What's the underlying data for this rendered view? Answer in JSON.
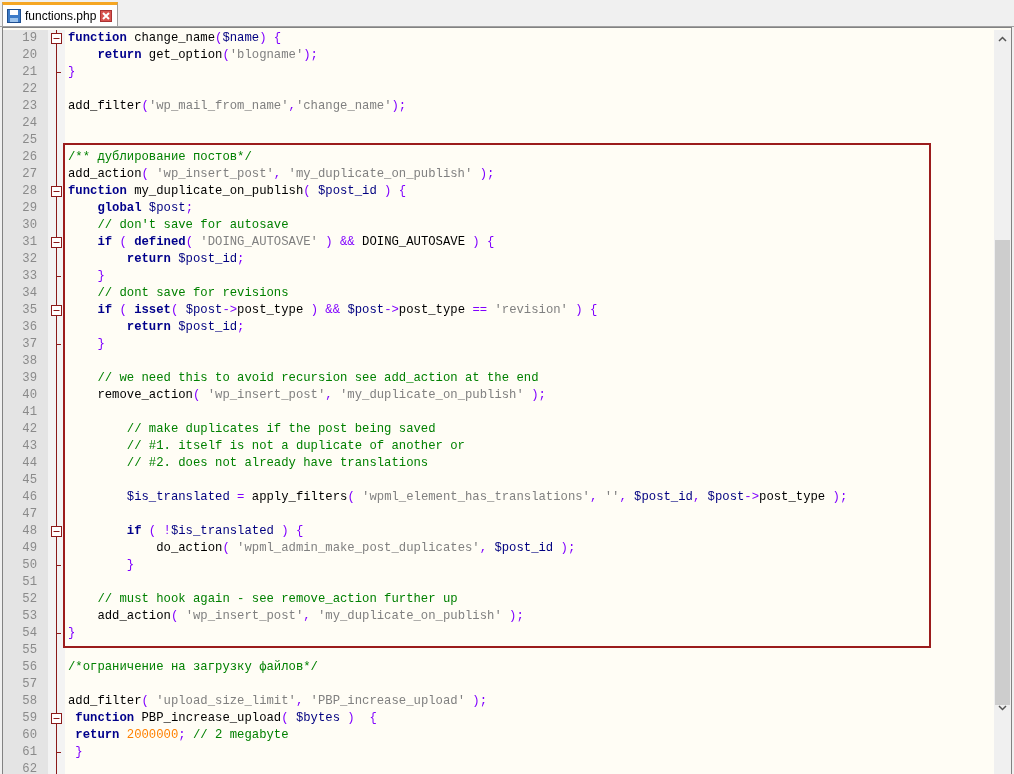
{
  "tabs": [
    {
      "label": "functions.php",
      "selected": true
    }
  ],
  "blocks": [
    {
      "kind": "plain",
      "lines": [
        {
          "number": "19",
          "fold_start": true,
          "tokens": [
            {
              "kind": "keyword",
              "text": "function"
            },
            {
              "kind": "plain",
              "text": " change_name"
            },
            {
              "kind": "operator",
              "text": "("
            },
            {
              "kind": "variable",
              "text": "$name"
            },
            {
              "kind": "operator",
              "text": ") {"
            }
          ]
        },
        {
          "number": "20",
          "tokens": [
            {
              "kind": "keyword",
              "text": "    return"
            },
            {
              "kind": "plain",
              "text": " get_option"
            },
            {
              "kind": "operator",
              "text": "("
            },
            {
              "kind": "string",
              "text": "'blogname'"
            },
            {
              "kind": "operator",
              "text": ");"
            }
          ]
        },
        {
          "number": "21",
          "fold_end": true,
          "tokens": [
            {
              "kind": "operator",
              "text": "}"
            }
          ]
        },
        {
          "number": "22"
        },
        {
          "number": "23",
          "tokens": [
            {
              "kind": "plain",
              "text": "add_filter"
            },
            {
              "kind": "operator",
              "text": "("
            },
            {
              "kind": "string",
              "text": "'wp_mail_from_name'"
            },
            {
              "kind": "operator",
              "text": ","
            },
            {
              "kind": "string",
              "text": "'change_name'"
            },
            {
              "kind": "operator",
              "text": ");"
            }
          ]
        },
        {
          "number": "24"
        },
        {
          "number": "25"
        }
      ]
    },
    {
      "kind": "framed",
      "lines": [
        {
          "number": "26",
          "tokens": [
            {
              "kind": "comment",
              "text": "/** дублирование постов*/"
            }
          ]
        },
        {
          "number": "27",
          "tokens": [
            {
              "kind": "plain",
              "text": "add_action"
            },
            {
              "kind": "operator",
              "text": "( "
            },
            {
              "kind": "string",
              "text": "'wp_insert_post'"
            },
            {
              "kind": "operator",
              "text": ", "
            },
            {
              "kind": "string",
              "text": "'my_duplicate_on_publish'"
            },
            {
              "kind": "operator",
              "text": " );"
            }
          ]
        },
        {
          "number": "28",
          "fold_start": true,
          "tokens": [
            {
              "kind": "keyword",
              "text": "function"
            },
            {
              "kind": "plain",
              "text": " my_duplicate_on_publish"
            },
            {
              "kind": "operator",
              "text": "( "
            },
            {
              "kind": "variable",
              "text": "$post_id"
            },
            {
              "kind": "operator",
              "text": " ) {"
            }
          ]
        },
        {
          "number": "29",
          "tokens": [
            {
              "kind": "keyword",
              "text": "    global"
            },
            {
              "kind": "variable",
              "text": " $post"
            },
            {
              "kind": "operator",
              "text": ";"
            }
          ]
        },
        {
          "number": "30",
          "tokens": [
            {
              "kind": "comment",
              "text": "    // don't save for autosave"
            }
          ]
        },
        {
          "number": "31",
          "fold_start": true,
          "tokens": [
            {
              "kind": "keyword",
              "text": "    if"
            },
            {
              "kind": "operator",
              "text": " ( "
            },
            {
              "kind": "keyword",
              "text": "defined"
            },
            {
              "kind": "operator",
              "text": "( "
            },
            {
              "kind": "string",
              "text": "'DOING_AUTOSAVE'"
            },
            {
              "kind": "operator",
              "text": " ) && "
            },
            {
              "kind": "plain",
              "text": "DOING_AUTOSAVE"
            },
            {
              "kind": "operator",
              "text": " ) {"
            }
          ]
        },
        {
          "number": "32",
          "tokens": [
            {
              "kind": "keyword",
              "text": "        return"
            },
            {
              "kind": "variable",
              "text": " $post_id"
            },
            {
              "kind": "operator",
              "text": ";"
            }
          ]
        },
        {
          "number": "33",
          "fold_end": true,
          "tokens": [
            {
              "kind": "operator",
              "text": "    }"
            }
          ]
        },
        {
          "number": "34",
          "tokens": [
            {
              "kind": "comment",
              "text": "    // dont save for revisions"
            }
          ]
        },
        {
          "number": "35",
          "fold_start": true,
          "tokens": [
            {
              "kind": "keyword",
              "text": "    if"
            },
            {
              "kind": "operator",
              "text": " ( "
            },
            {
              "kind": "keyword",
              "text": "isset"
            },
            {
              "kind": "operator",
              "text": "( "
            },
            {
              "kind": "variable",
              "text": "$post"
            },
            {
              "kind": "operator",
              "text": "->"
            },
            {
              "kind": "plain",
              "text": "post_type"
            },
            {
              "kind": "operator",
              "text": " ) && "
            },
            {
              "kind": "variable",
              "text": "$post"
            },
            {
              "kind": "operator",
              "text": "->"
            },
            {
              "kind": "plain",
              "text": "post_type"
            },
            {
              "kind": "operator",
              "text": " == "
            },
            {
              "kind": "string",
              "text": "'revision'"
            },
            {
              "kind": "operator",
              "text": " ) {"
            }
          ]
        },
        {
          "number": "36",
          "tokens": [
            {
              "kind": "keyword",
              "text": "        return"
            },
            {
              "kind": "variable",
              "text": " $post_id"
            },
            {
              "kind": "operator",
              "text": ";"
            }
          ]
        },
        {
          "number": "37",
          "fold_end": true,
          "tokens": [
            {
              "kind": "operator",
              "text": "    }"
            }
          ]
        },
        {
          "number": "38"
        },
        {
          "number": "39",
          "tokens": [
            {
              "kind": "comment",
              "text": "    // we need this to avoid recursion see add_action at the end"
            }
          ]
        },
        {
          "number": "40",
          "tokens": [
            {
              "kind": "plain",
              "text": "    remove_action"
            },
            {
              "kind": "operator",
              "text": "( "
            },
            {
              "kind": "string",
              "text": "'wp_insert_post'"
            },
            {
              "kind": "operator",
              "text": ", "
            },
            {
              "kind": "string",
              "text": "'my_duplicate_on_publish'"
            },
            {
              "kind": "operator",
              "text": " );"
            }
          ]
        },
        {
          "number": "41"
        },
        {
          "number": "42",
          "tokens": [
            {
              "kind": "comment",
              "text": "        // make duplicates if the post being saved"
            }
          ]
        },
        {
          "number": "43",
          "tokens": [
            {
              "kind": "comment",
              "text": "        // #1. itself is not a duplicate of another or"
            }
          ]
        },
        {
          "number": "44",
          "tokens": [
            {
              "kind": "comment",
              "text": "        // #2. does not already have translations"
            }
          ]
        },
        {
          "number": "45"
        },
        {
          "number": "46",
          "tokens": [
            {
              "kind": "variable",
              "text": "        $is_translated"
            },
            {
              "kind": "operator",
              "text": " = "
            },
            {
              "kind": "plain",
              "text": "apply_filters"
            },
            {
              "kind": "operator",
              "text": "( "
            },
            {
              "kind": "string",
              "text": "'wpml_element_has_translations'"
            },
            {
              "kind": "operator",
              "text": ", "
            },
            {
              "kind": "string",
              "text": "''"
            },
            {
              "kind": "operator",
              "text": ", "
            },
            {
              "kind": "variable",
              "text": "$post_id"
            },
            {
              "kind": "operator",
              "text": ", "
            },
            {
              "kind": "variable",
              "text": "$post"
            },
            {
              "kind": "operator",
              "text": "->"
            },
            {
              "kind": "plain",
              "text": "post_type"
            },
            {
              "kind": "operator",
              "text": " );"
            }
          ]
        },
        {
          "number": "47"
        },
        {
          "number": "48",
          "fold_start": true,
          "tokens": [
            {
              "kind": "keyword",
              "text": "        if"
            },
            {
              "kind": "operator",
              "text": " ( !"
            },
            {
              "kind": "variable",
              "text": "$is_translated"
            },
            {
              "kind": "operator",
              "text": " ) {"
            }
          ]
        },
        {
          "number": "49",
          "tokens": [
            {
              "kind": "plain",
              "text": "            do_action"
            },
            {
              "kind": "operator",
              "text": "( "
            },
            {
              "kind": "string",
              "text": "'wpml_admin_make_post_duplicates'"
            },
            {
              "kind": "operator",
              "text": ", "
            },
            {
              "kind": "variable",
              "text": "$post_id"
            },
            {
              "kind": "operator",
              "text": " );"
            }
          ]
        },
        {
          "number": "50",
          "fold_end": true,
          "tokens": [
            {
              "kind": "operator",
              "text": "        }"
            }
          ]
        },
        {
          "number": "51"
        },
        {
          "number": "52",
          "tokens": [
            {
              "kind": "comment",
              "text": "    // must hook again - see remove_action further up"
            }
          ]
        },
        {
          "number": "53",
          "tokens": [
            {
              "kind": "plain",
              "text": "    add_action"
            },
            {
              "kind": "operator",
              "text": "( "
            },
            {
              "kind": "string",
              "text": "'wp_insert_post'"
            },
            {
              "kind": "operator",
              "text": ", "
            },
            {
              "kind": "string",
              "text": "'my_duplicate_on_publish'"
            },
            {
              "kind": "operator",
              "text": " );"
            }
          ]
        },
        {
          "number": "54",
          "fold_end": true,
          "tokens": [
            {
              "kind": "operator",
              "text": "}"
            }
          ]
        }
      ]
    },
    {
      "kind": "plain",
      "lines": [
        {
          "number": "55"
        },
        {
          "number": "56",
          "tokens": [
            {
              "kind": "comment",
              "text": "/*ограничение на загрузку файлов*/"
            }
          ]
        },
        {
          "number": "57"
        },
        {
          "number": "58",
          "tokens": [
            {
              "kind": "plain",
              "text": "add_filter"
            },
            {
              "kind": "operator",
              "text": "( "
            },
            {
              "kind": "string",
              "text": "'upload_size_limit'"
            },
            {
              "kind": "operator",
              "text": ", "
            },
            {
              "kind": "string",
              "text": "'PBP_increase_upload'"
            },
            {
              "kind": "operator",
              "text": " );"
            }
          ]
        },
        {
          "number": "59",
          "fold_start": true,
          "tokens": [
            {
              "kind": "keyword",
              "text": " function"
            },
            {
              "kind": "plain",
              "text": " PBP_increase_upload"
            },
            {
              "kind": "operator",
              "text": "( "
            },
            {
              "kind": "variable",
              "text": "$bytes"
            },
            {
              "kind": "operator",
              "text": " )  {"
            }
          ]
        },
        {
          "number": "60",
          "tokens": [
            {
              "kind": "keyword",
              "text": " return"
            },
            {
              "kind": "number",
              "text": " 2000000"
            },
            {
              "kind": "operator",
              "text": ";"
            },
            {
              "kind": "comment",
              "text": " // 2 megabyte"
            }
          ]
        },
        {
          "number": "61",
          "fold_end": true,
          "tokens": [
            {
              "kind": "operator",
              "text": " }"
            }
          ]
        },
        {
          "number": "62"
        }
      ]
    }
  ]
}
